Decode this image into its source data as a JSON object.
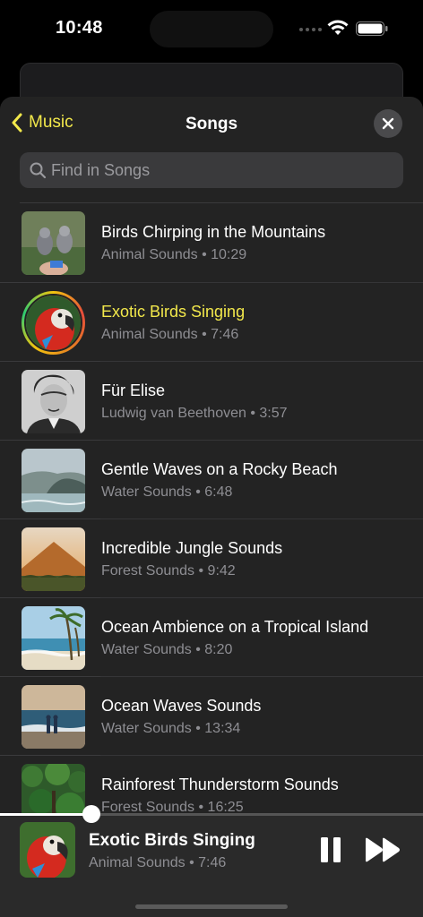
{
  "status_bar": {
    "time": "10:48"
  },
  "nav": {
    "back_label": "Music",
    "title": "Songs"
  },
  "search": {
    "placeholder": "Find in Songs"
  },
  "songs": [
    {
      "title": "Birds Chirping in the Mountains",
      "subtitle": "Animal Sounds • 10:29",
      "art": "birds-on-hand"
    },
    {
      "title": "Exotic Birds Singing",
      "subtitle": "Animal Sounds • 7:46",
      "art": "parrot",
      "playing": true
    },
    {
      "title": "Für Elise",
      "subtitle": "Ludwig van Beethoven • 3:57",
      "art": "beethoven-portrait"
    },
    {
      "title": "Gentle Waves on a Rocky Beach",
      "subtitle": "Water Sounds • 6:48",
      "art": "rocky-beach"
    },
    {
      "title": "Incredible Jungle Sounds",
      "subtitle": "Forest Sounds • 9:42",
      "art": "mountain-sunset"
    },
    {
      "title": "Ocean Ambience on a Tropical Island",
      "subtitle": "Water Sounds • 8:20",
      "art": "palm-beach"
    },
    {
      "title": "Ocean Waves Sounds",
      "subtitle": "Water Sounds • 13:34",
      "art": "couple-on-shore"
    },
    {
      "title": "Rainforest Thunderstorm Sounds",
      "subtitle": "Forest Sounds • 16:25",
      "art": "rainforest"
    }
  ],
  "player": {
    "title": "Exotic Birds Singing",
    "subtitle": "Animal Sounds • 7:46",
    "progress": 0.216,
    "art": "parrot"
  },
  "colors": {
    "accent": "#f2e84b",
    "sheet": "#232323",
    "secondary_text": "#8e8e93"
  }
}
